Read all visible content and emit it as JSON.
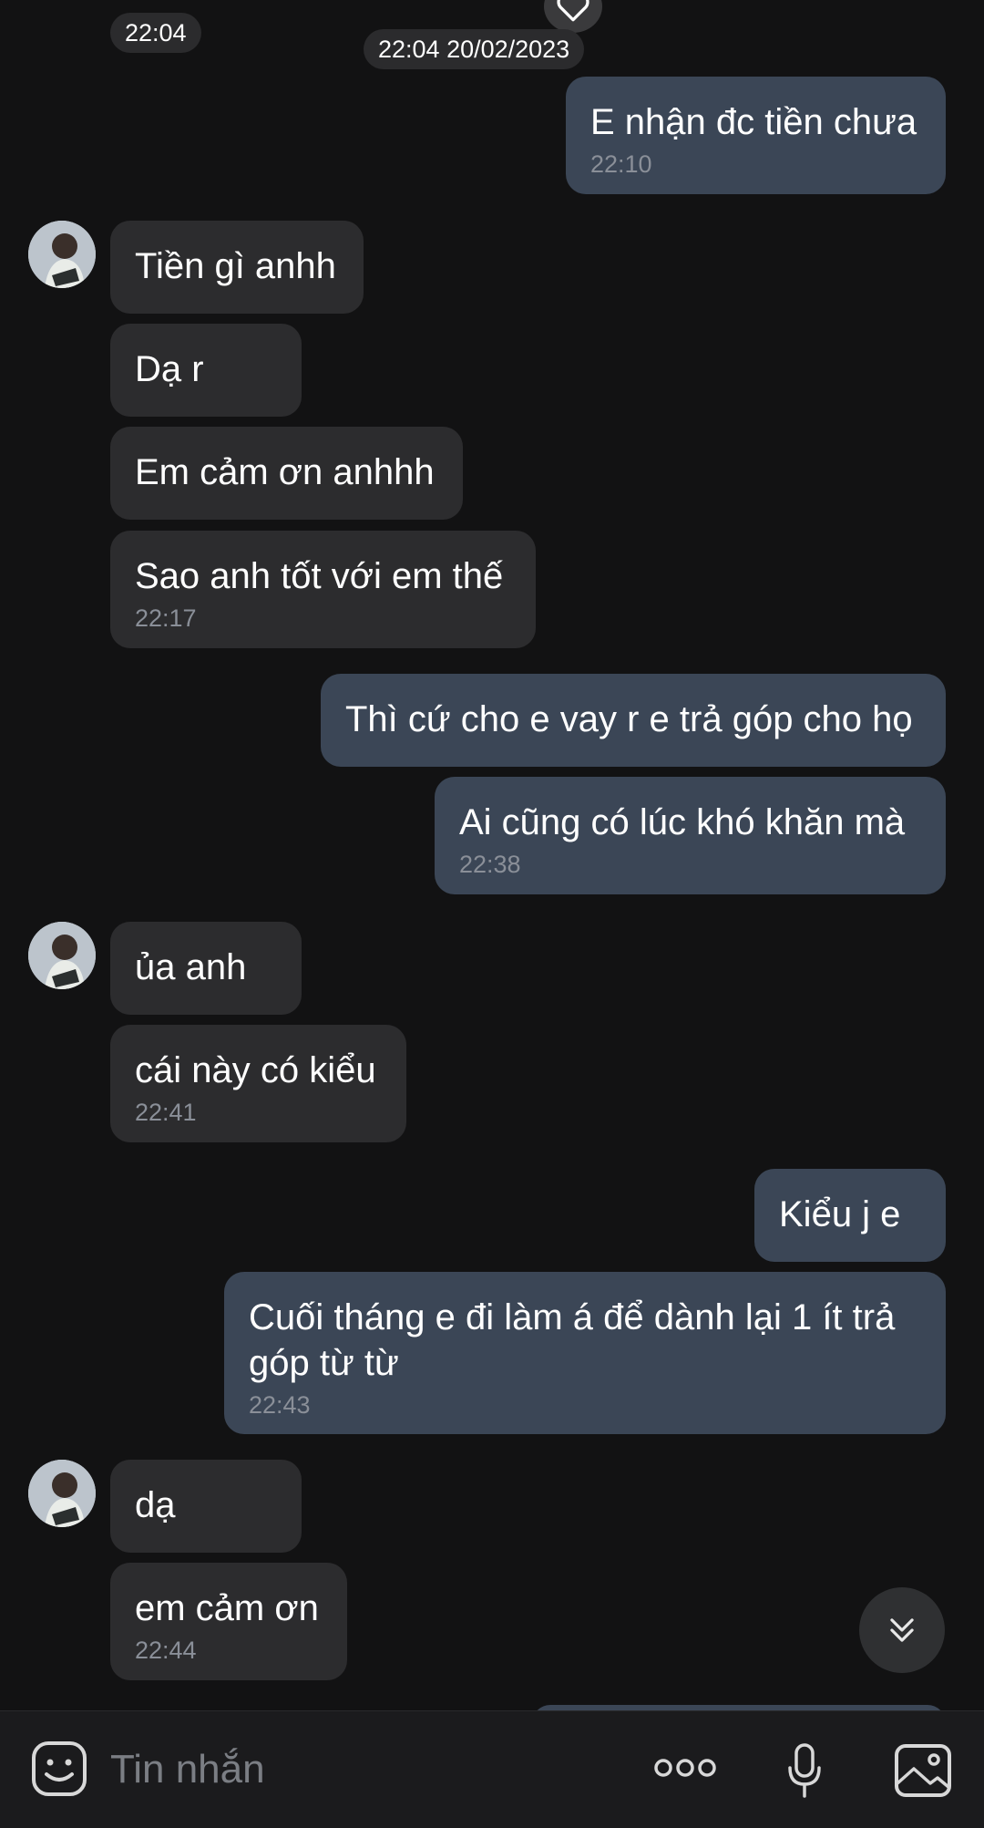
{
  "timestamps": {
    "top_left": "22:04",
    "date_chip": "22:04 20/02/2023"
  },
  "messages": [
    {
      "dir": "out",
      "text": "E nhận đc tiền chưa",
      "time": "22:10"
    },
    {
      "dir": "in",
      "text": "Tiền gì anhh",
      "time": ""
    },
    {
      "dir": "in",
      "text": "Dạ r",
      "time": ""
    },
    {
      "dir": "in",
      "text": "Em cảm ơn anhhh",
      "time": ""
    },
    {
      "dir": "in",
      "text": "Sao anh tốt với em thế",
      "time": "22:17"
    },
    {
      "dir": "out",
      "text": "Thì cứ cho e vay r e trả góp cho họ",
      "time": ""
    },
    {
      "dir": "out",
      "text": "Ai cũng có lúc khó khăn mà",
      "time": "22:38"
    },
    {
      "dir": "in",
      "text": "ủa anh",
      "time": ""
    },
    {
      "dir": "in",
      "text": "cái này có kiểu",
      "time": "22:41"
    },
    {
      "dir": "out",
      "text": "Kiểu j e",
      "time": ""
    },
    {
      "dir": "out",
      "text": "Cuối tháng e đi làm á để dành lại 1 ít trả\ngóp từ từ",
      "time": "22:43"
    },
    {
      "dir": "in",
      "text": "dạ",
      "time": ""
    },
    {
      "dir": "in",
      "text": "em cảm ơn",
      "time": "22:44"
    }
  ],
  "composer": {
    "placeholder": "Tin nhắn",
    "icons": [
      "emoji-icon",
      "more-icon",
      "microphone-icon",
      "image-icon"
    ]
  },
  "colors": {
    "background": "#121213",
    "incoming_bubble": "#2c2c2e",
    "outgoing_bubble": "#3b4656",
    "timestamp": "#8a8f98"
  }
}
